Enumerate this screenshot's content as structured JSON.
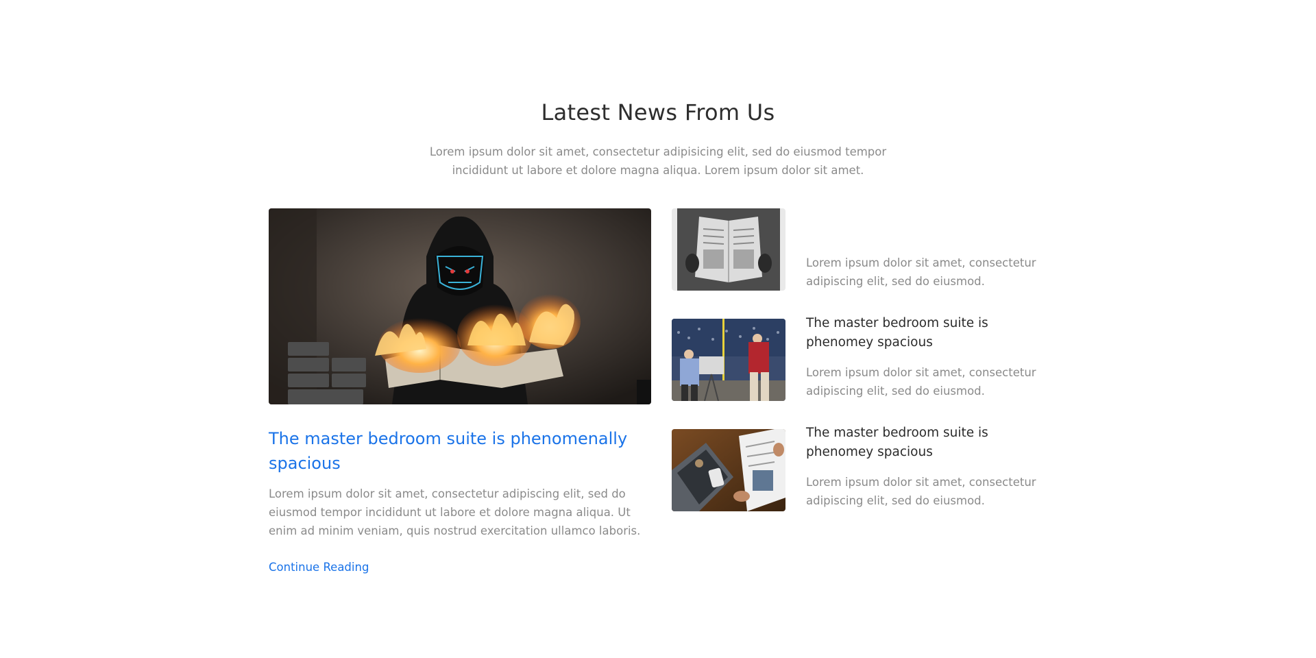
{
  "section": {
    "title": "Latest News From Us",
    "subtitle": "Lorem ipsum dolor sit amet, consectetur adipisicing elit, sed do eiusmod tempor incididunt ut labore et dolore magna aliqua. Lorem ipsum dolor sit amet."
  },
  "featured": {
    "image_icon": "hooded-man-burning-newspaper-photo",
    "title": "The master bedroom suite is phenomenally  spacious",
    "excerpt": "Lorem ipsum dolor sit amet, consectetur adipiscing elit, sed do eiusmod tempor incididunt ut labore et dolore magna aliqua. Ut enim ad minim veniam, quis nostrud exercitation ullamco laboris.",
    "link_label": "Continue Reading"
  },
  "side_posts": [
    {
      "image_icon": "person-reading-newspaper-photo",
      "title": "",
      "excerpt": "Lorem ipsum dolor sit amet, consectetur adipiscing elit, sed do eiusmod."
    },
    {
      "image_icon": "stadium-camera-crew-photo",
      "title": "The master bedroom suite is phenomey spacious",
      "excerpt": "Lorem ipsum dolor sit amet, consectetur adipiscing elit, sed do eiusmod."
    },
    {
      "image_icon": "business-newspaper-laptop-photo",
      "title": "The master bedroom suite is phenomey spacious",
      "excerpt": "Lorem ipsum dolor sit amet, consectetur adipiscing elit, sed do eiusmod."
    }
  ],
  "colors": {
    "accent": "#1a73e8",
    "heading": "#2d2d2d",
    "body_text": "#8a8a8a",
    "background": "#ffffff"
  }
}
